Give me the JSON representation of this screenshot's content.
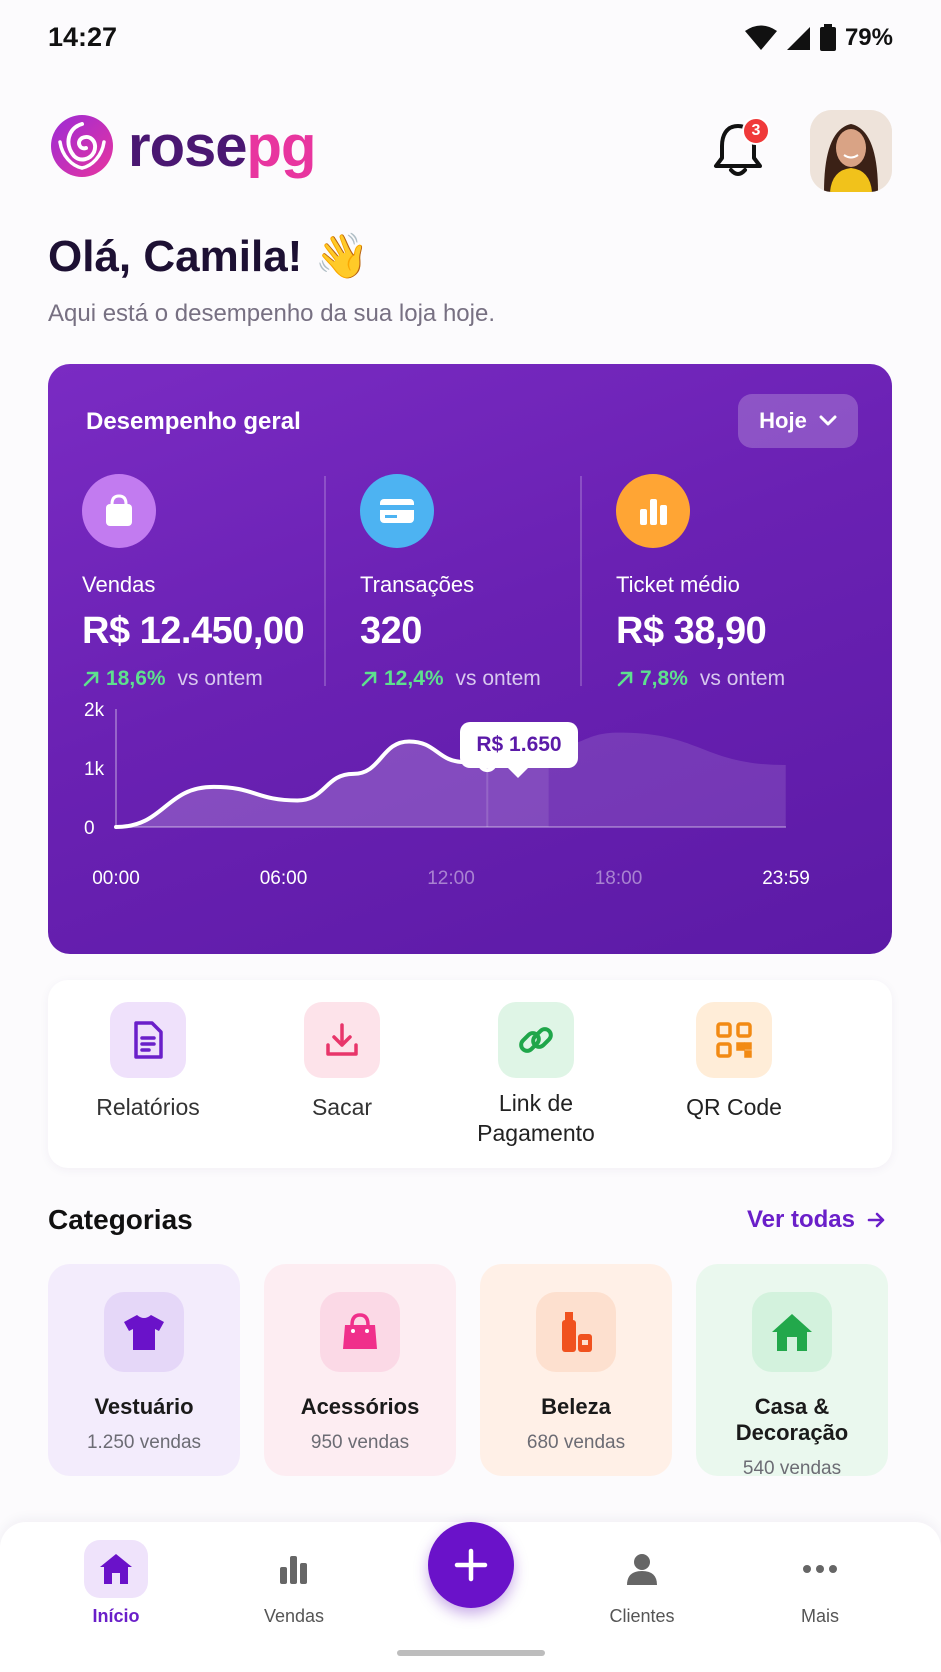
{
  "status_bar": {
    "time": "14:27",
    "battery": "79%"
  },
  "header": {
    "logo_part1": "rose",
    "logo_part2": "pg",
    "notification_count": "3",
    "greeting": "Olá, Camila! 👋",
    "subtitle": "Aqui está o desempenho da sua loja hoje."
  },
  "performance": {
    "title": "Desempenho geral",
    "filter": "Hoje",
    "metrics": [
      {
        "label": "Vendas",
        "value": "R$ 12.450,00",
        "change": "18,6%",
        "compare": "vs ontem",
        "icon": "shopping-bag-icon"
      },
      {
        "label": "Transações",
        "value": "320",
        "change": "12,4%",
        "compare": "vs ontem",
        "icon": "credit-card-icon"
      },
      {
        "label": "Ticket médio",
        "value": "R$ 38,90",
        "change": "7,8%",
        "compare": "vs ontem",
        "icon": "bar-chart-icon"
      }
    ],
    "tooltip": "R$ 1.650"
  },
  "chart_data": {
    "type": "area",
    "x_ticks": [
      "00:00",
      "06:00",
      "12:00",
      "18:00",
      "23:59"
    ],
    "y_ticks": [
      "0",
      "1k",
      "2k"
    ],
    "ylim": [
      0,
      2000
    ],
    "series": [
      {
        "x": [
          0,
          3.5,
          6.5,
          8.5,
          10.5,
          12.5,
          15.5
        ],
        "values": [
          0,
          680,
          450,
          900,
          1450,
          1100,
          1350
        ]
      }
    ],
    "forecast": {
      "x": [
        15.5,
        18,
        23.99
      ],
      "values": [
        1350,
        1600,
        1050
      ]
    },
    "highlight": {
      "x": 13.3,
      "value": 1100,
      "label": "R$ 1.650"
    }
  },
  "actions": [
    {
      "label": "Relatórios",
      "icon": "report-icon"
    },
    {
      "label": "Sacar",
      "icon": "download-icon"
    },
    {
      "label": "Link de Pagamento",
      "icon": "link-icon"
    },
    {
      "label": "QR Code",
      "icon": "qr-code-icon"
    }
  ],
  "categories": {
    "title": "Categorias",
    "link": "Ver todas",
    "items": [
      {
        "name": "Vestuário",
        "sales": "1.250 vendas",
        "icon": "tshirt-icon"
      },
      {
        "name": "Acessórios",
        "sales": "950 vendas",
        "icon": "handbag-icon"
      },
      {
        "name": "Beleza",
        "sales": "680 vendas",
        "icon": "cosmetics-icon"
      },
      {
        "name": "Casa & Decoração",
        "sales": "540 vendas",
        "icon": "house-icon"
      }
    ]
  },
  "bottom_nav": [
    {
      "label": "Início",
      "icon": "home-icon"
    },
    {
      "label": "Vendas",
      "icon": "bar-chart-icon"
    },
    {
      "label": "Clientes",
      "icon": "user-icon"
    },
    {
      "label": "Mais",
      "icon": "more-icon"
    }
  ],
  "colors": {
    "primary": "#6a1fc9",
    "card_bg": "#6a21b3",
    "positive": "#5ee08e",
    "brand_pink": "#e8359f"
  }
}
